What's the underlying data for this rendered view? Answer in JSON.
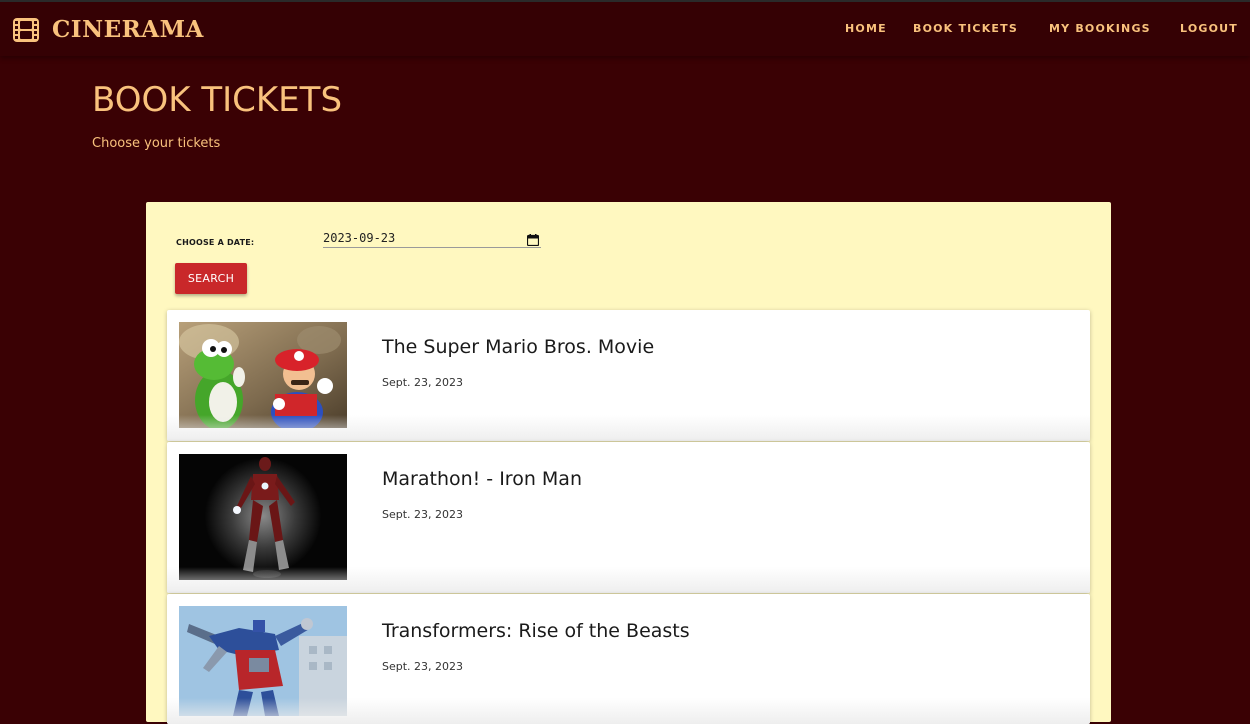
{
  "brand": {
    "name": "CINERAMA",
    "icon": "film-icon",
    "color": "#f9c27d"
  },
  "nav": {
    "home": "HOME",
    "book_tickets": "BOOK TICKETS",
    "my_bookings": "MY BOOKINGS",
    "logout": "LOGOUT"
  },
  "page": {
    "title": "BOOK TICKETS",
    "subtitle": "Choose your tickets"
  },
  "search": {
    "date_label": "CHOOSE A DATE:",
    "date_value": "2023-09-23",
    "calendar_icon": "calendar-icon",
    "button_label": "SEARCH",
    "button_color": "#c9282a"
  },
  "movies": [
    {
      "title": "The Super Mario Bros. Movie",
      "date": "Sept. 23, 2023"
    },
    {
      "title": "Marathon! - Iron Man",
      "date": "Sept. 23, 2023"
    },
    {
      "title": "Transformers: Rise of the Beasts",
      "date": "Sept. 23, 2023"
    }
  ],
  "colors": {
    "background": "#3a0104",
    "navbar": "#350104",
    "accent": "#f9c27d",
    "panel": "#fff8c0"
  }
}
